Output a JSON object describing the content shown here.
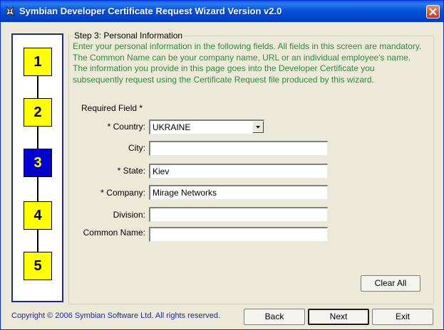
{
  "window": {
    "title": "Symbian Developer Certificate Request Wizard Version v2.0"
  },
  "steps": [
    {
      "number": "1",
      "active": false
    },
    {
      "number": "2",
      "active": false
    },
    {
      "number": "3",
      "active": true
    },
    {
      "number": "4",
      "active": false
    },
    {
      "number": "5",
      "active": false
    }
  ],
  "step_info": {
    "title": "Step 3: Personal Information",
    "instructions": "Enter your personal information in the following fields. All fields in this screen are mandatory. The Common Name can be your company name, URL or an individual employee's name. The information you provide in this page goes into the Developer Certificate you subsequently request using the Certificate Request file produced by this wizard."
  },
  "form": {
    "required_note": "Required Field *",
    "country": {
      "label": "* Country:",
      "value": "UKRAINE"
    },
    "city": {
      "label": "City:",
      "value": ""
    },
    "state": {
      "label": "* State:",
      "value": "Kiev"
    },
    "company": {
      "label": "* Company:",
      "value": "Mirage Networks"
    },
    "division": {
      "label": "Division:",
      "value": ""
    },
    "common_name": {
      "label": "Common Name:",
      "value": ""
    }
  },
  "buttons": {
    "clear_all": "Clear All",
    "back": "Back",
    "next": "Next",
    "exit": "Exit"
  },
  "footer": {
    "copyright": "Copyright © 2006 Symbian Software Ltd. All rights reserved."
  },
  "colors": {
    "step_inactive": "#ffff00",
    "step_active": "#0000d0",
    "instruction_text": "#2e8b3a",
    "title_bar": "#0453d9"
  },
  "icons": [
    "app-icon",
    "close-icon",
    "chevron-down-icon"
  ]
}
